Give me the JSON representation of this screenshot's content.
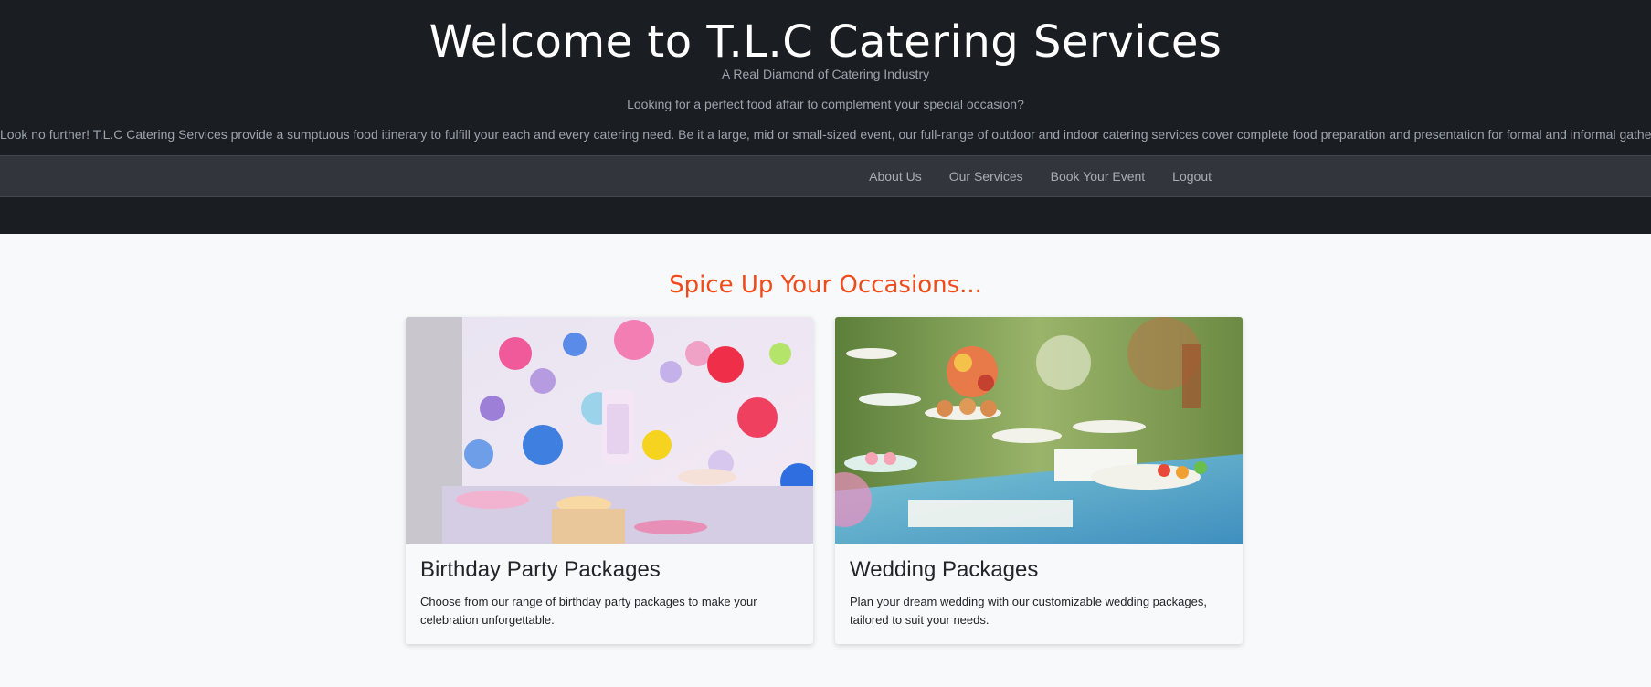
{
  "header": {
    "title": "Welcome to T.L.C Catering Services",
    "tagline": "A Real Diamond of Catering Industry",
    "question": "Looking for a perfect food affair to complement your special occasion?",
    "description": "Look no further! T.L.C Catering Services provide a sumptuous food itinerary to fulfill your each and every catering need. Be it a large, mid or small-sized event, our full-range of outdoor and indoor catering services cover complete food preparation and presentation for formal and informal gatherings."
  },
  "nav": {
    "items": [
      {
        "label": "About Us"
      },
      {
        "label": "Our Services"
      },
      {
        "label": "Book Your Event"
      },
      {
        "label": "Logout"
      }
    ]
  },
  "main": {
    "heading": "Spice Up Your Occasions...",
    "cards": [
      {
        "title": "Birthday Party Packages",
        "text": "Choose from our range of birthday party packages to make your celebration unforgettable."
      },
      {
        "title": "Wedding Packages",
        "text": "Plan your dream wedding with our customizable wedding packages, tailored to suit your needs."
      }
    ]
  },
  "colors": {
    "header_bg": "#1a1d21",
    "navbar_bg": "#32363c",
    "accent": "#f14a1b",
    "page_bg": "#f8f9fa"
  }
}
